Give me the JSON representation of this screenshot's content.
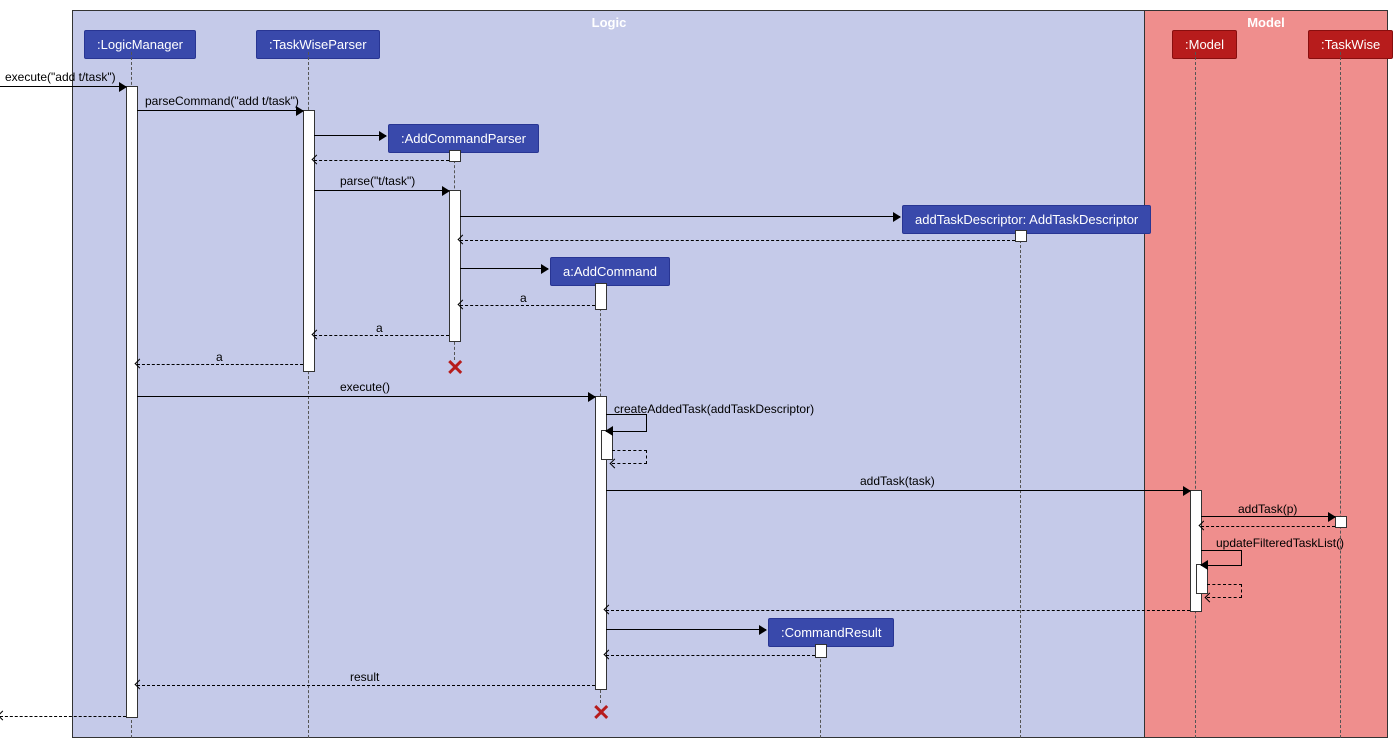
{
  "regions": {
    "logic": "Logic",
    "model": "Model"
  },
  "participants": {
    "logicManager": ":LogicManager",
    "taskWiseParser": ":TaskWiseParser",
    "addCommandParser": ":AddCommandParser",
    "addCommand": "a:AddCommand",
    "addTaskDescriptor": "addTaskDescriptor: AddTaskDescriptor",
    "commandResult": ":CommandResult",
    "model": ":Model",
    "taskWise": ":TaskWise"
  },
  "messages": {
    "execute_add": "execute(\"add t/task\")",
    "parseCommand": "parseCommand(\"add t/task\")",
    "parse": "parse(\"t/task\")",
    "a": "a",
    "execute": "execute()",
    "createAddedTask": "createAddedTask(addTaskDescriptor)",
    "addTask": "addTask(task)",
    "addTaskP": "addTask(p)",
    "updateFilteredTaskList": "updateFilteredTaskList()",
    "result": "result"
  }
}
